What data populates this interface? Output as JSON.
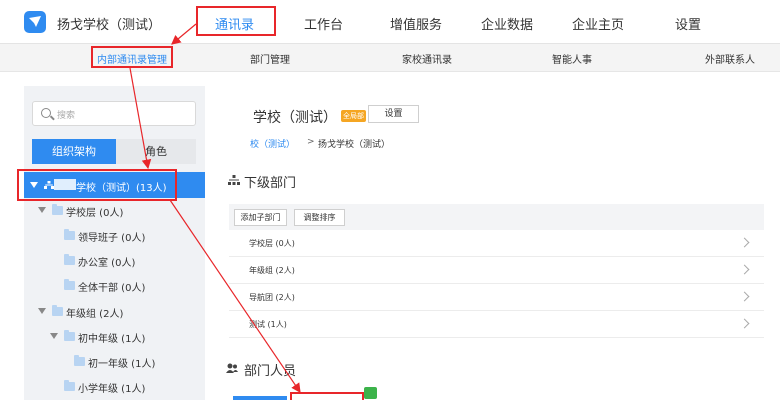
{
  "header": {
    "brand": "扬戈学校（测试）",
    "nav": [
      "通讯录",
      "工作台",
      "增值服务",
      "企业数据",
      "企业主页",
      "设置"
    ],
    "active_nav": "通讯录"
  },
  "subnav": {
    "items": [
      "内部通讯录管理",
      "部门管理",
      "家校通讯录",
      "智能人事",
      "外部联系人"
    ],
    "active": "内部通讯录管理"
  },
  "sidebar": {
    "search_placeholder": "搜索",
    "tabs": [
      "组织架构",
      "角色"
    ],
    "tree": {
      "root": "学校（测试）(13人)",
      "nodes": [
        "学校层 (0人)",
        "领导班子 (0人)",
        "办公室 (0人)",
        "全体干部 (0人)",
        "年级组 (2人)",
        "初中年级 (1人)",
        "初一年级 (1人)",
        "小学年级 (1人)"
      ]
    }
  },
  "main": {
    "title": "学校（测试）",
    "badge": "全局部",
    "settings_label": "设置",
    "breadcrumb": {
      "link": "校（测试）",
      "sep": ">",
      "current": "扬戈学校（测试）"
    },
    "subdept_title": "下级部门",
    "buttons": [
      "添加子部门",
      "调整排序"
    ],
    "departments": [
      "学校层 (0人)",
      "年级组 (2人)",
      "导航团 (2人)",
      "测试 (1人)"
    ],
    "members_title": "部门人员"
  },
  "colors": {
    "accent": "#2f8bf0",
    "annotation": "#e8262a"
  }
}
